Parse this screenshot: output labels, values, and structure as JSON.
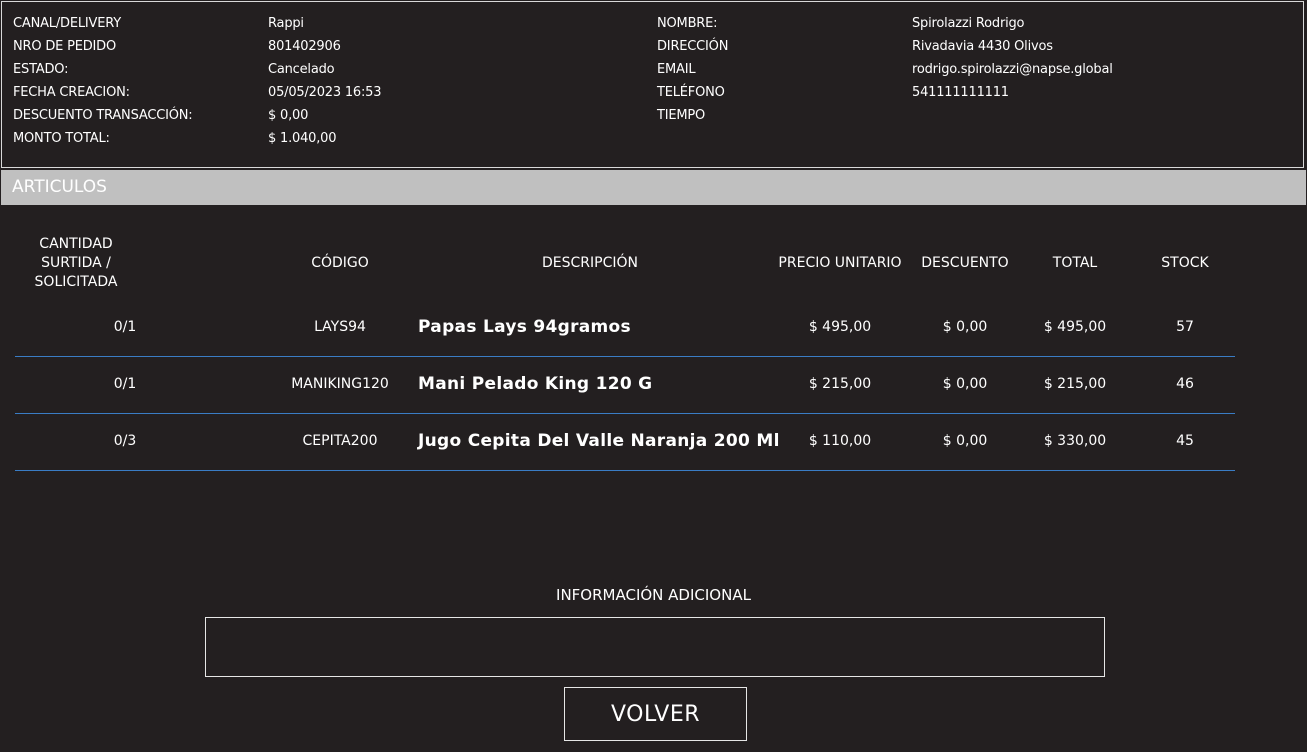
{
  "order_info": {
    "left_labels": [
      "CANAL/DELIVERY",
      "NRO DE PEDIDO",
      "ESTADO:",
      "FECHA CREACION:",
      "DESCUENTO TRANSACCIÓN:",
      "MONTO TOTAL:"
    ],
    "left_values": [
      "Rappi",
      "801402906",
      "Cancelado",
      "05/05/2023 16:53",
      "$ 0,00",
      "$ 1.040,00"
    ],
    "right_labels": [
      "NOMBRE:",
      "DIRECCIÓN",
      "EMAIL",
      "TELÉFONO",
      "TIEMPO"
    ],
    "right_values": [
      "Spirolazzi Rodrigo",
      "Rivadavia 4430 Olivos",
      "rodrigo.spirolazzi@napse.global",
      "541111111111",
      ""
    ]
  },
  "articles_section": {
    "title": "ARTICULOS"
  },
  "table": {
    "headers": {
      "quantity": "CANTIDAD SURTIDA / SOLICITADA",
      "code": "CÓDIGO",
      "description": "DESCRIPCIÓN",
      "unit_price": "PRECIO UNITARIO",
      "discount": "DESCUENTO",
      "total": "TOTAL",
      "stock": "STOCK"
    },
    "rows": [
      {
        "quantity": "0/1",
        "code": "LAYS94",
        "description": "Papas Lays 94gramos",
        "unit_price": "$ 495,00",
        "discount": "$ 0,00",
        "total": "$ 495,00",
        "stock": "57"
      },
      {
        "quantity": "0/1",
        "code": "MANIKING120",
        "description": "Mani Pelado King 120 G",
        "unit_price": "$ 215,00",
        "discount": "$ 0,00",
        "total": "$ 215,00",
        "stock": "46"
      },
      {
        "quantity": "0/3",
        "code": "CEPITA200",
        "description": "Jugo Cepita Del Valle Naranja 200 Ml",
        "unit_price": "$ 110,00",
        "discount": "$ 0,00",
        "total": "$ 330,00",
        "stock": "45"
      }
    ]
  },
  "additional_info": {
    "label": "INFORMACIÓN ADICIONAL",
    "value": ""
  },
  "actions": {
    "back_label": "VOLVER"
  },
  "colors": {
    "background": "#231f20",
    "section_bar": "#c0c0c0",
    "row_separator": "#3a7cc4",
    "text": "#ffffff"
  }
}
